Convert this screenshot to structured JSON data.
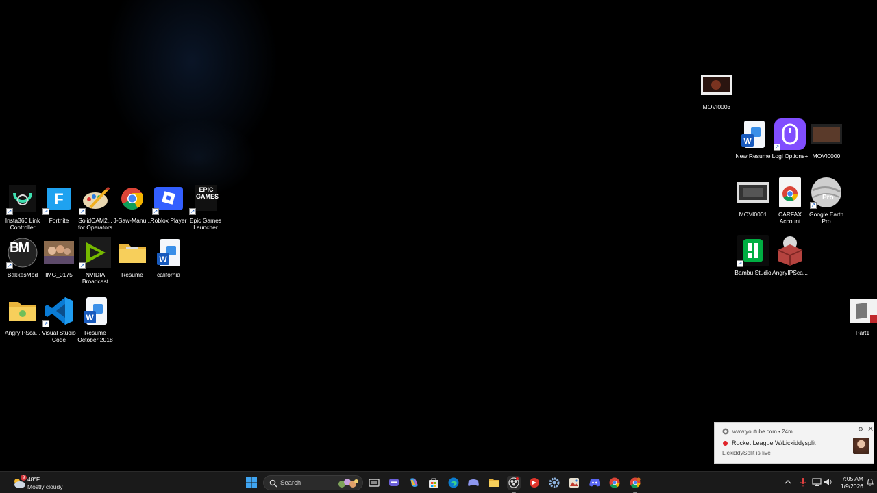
{
  "desktop": {
    "icons": [
      {
        "label": "Insta360 Link Controller"
      },
      {
        "label": "Fortnite"
      },
      {
        "label": "SolidCAM2... for Operators"
      },
      {
        "label": "J-Saw-Manu..."
      },
      {
        "label": "Roblox Player"
      },
      {
        "label": "Epic Games Launcher"
      },
      {
        "label": "BakkesMod"
      },
      {
        "label": "IMG_0175"
      },
      {
        "label": "NVIDIA Broadcast"
      },
      {
        "label": "Resume"
      },
      {
        "label": "california"
      },
      {
        "label": "AngryIPSca..."
      },
      {
        "label": "Visual Studio Code"
      },
      {
        "label": "Resume October 2018"
      },
      {
        "label": "MOVI0003"
      },
      {
        "label": "New Resume"
      },
      {
        "label": "Logi Options+"
      },
      {
        "label": "MOVI0000"
      },
      {
        "label": "MOVI0001"
      },
      {
        "label": "CARFAX Account"
      },
      {
        "label": "Google Earth Pro"
      },
      {
        "label": "Bambu Studio"
      },
      {
        "label": "AngryIPSca..."
      },
      {
        "label": "Part1"
      }
    ],
    "epic_text": "EPIC GAMES",
    "bm_text": "BM",
    "pro_text": "Pro"
  },
  "taskbar": {
    "weather": {
      "temperature": "48°F",
      "condition": "Mostly cloudy",
      "badge": "9"
    },
    "search": {
      "placeholder": "Search"
    },
    "clock": {
      "time": "7:05 AM",
      "date": "1/9/2026"
    }
  },
  "notification": {
    "source": "www.youtube.com  •  24m",
    "title": "Rocket League W/Lickiddysplit",
    "message": "LickiddySplit is live"
  },
  "colors": {
    "taskbar_bg": "#1a1a1a",
    "toast_bg": "#f3f3f3",
    "live_red": "#e0242a"
  }
}
